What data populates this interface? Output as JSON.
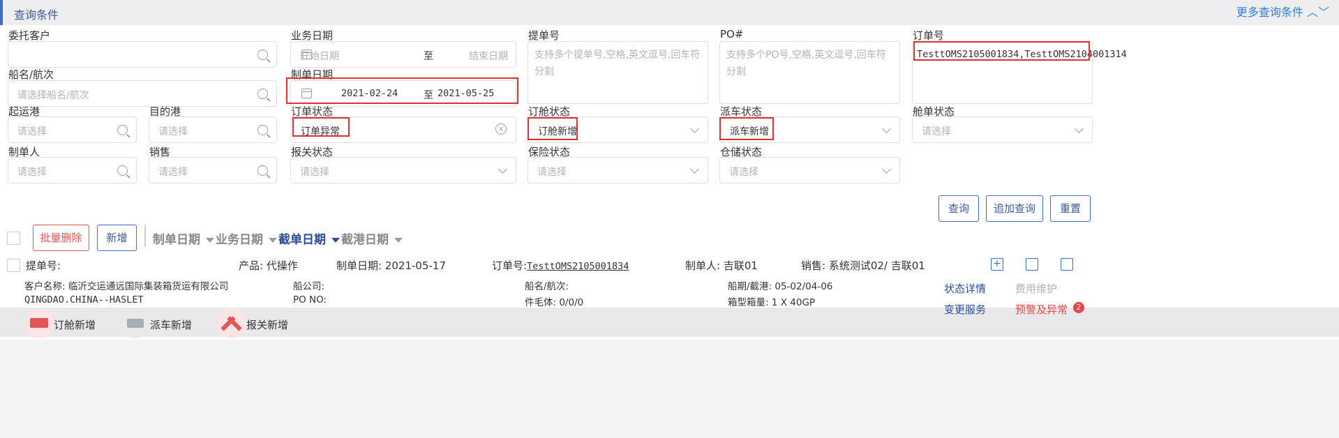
{
  "header": {
    "title": "查询条件",
    "more": "更多查询条件"
  },
  "labels": {
    "client": "委托客户",
    "biz_date": "业务日期",
    "bl_no": "提单号",
    "po": "PO#",
    "order_no": "订单号",
    "vessel": "船名/航次",
    "create_date": "制单日期",
    "pol": "起运港",
    "pod": "目的港",
    "order_status": "订单状态",
    "booking_status": "订舱状态",
    "truck_status": "派车状态",
    "manifest_status": "舱单状态",
    "creator": "制单人",
    "sales": "销售",
    "customs_status": "报关状态",
    "insurance_status": "保险状态",
    "warehouse_status": "仓储状态"
  },
  "inputs": {
    "vessel_ph": "请选择船名/航次",
    "select_ph": "请选择",
    "biz_start_ph": "开始日期",
    "to": "至",
    "biz_end_ph": "结束日期",
    "create_start": "2021-02-24",
    "create_end": "2021-05-25",
    "bl_ph": "支持多个提单号,空格,英文逗号,回车符分割",
    "po_ph": "支持多个PO号,空格,英文逗号,回车符分割",
    "order_no_value": "TesttOMS2105001834,TesttOMS2104001314",
    "order_status_value": "订单异常",
    "booking_status_value": "订舱新增",
    "truck_status_value": "派车新增"
  },
  "buttons": {
    "query": "查询",
    "append_query": "追加查询",
    "reset": "重置",
    "batch_delete": "批量删除",
    "add": "新增"
  },
  "sort": [
    "制单日期",
    "业务日期",
    "截单日期",
    "截港日期"
  ],
  "row": {
    "bl": "提单号:",
    "product": "产品: 代操作",
    "create_date": "制单日期: 2021-05-17",
    "order_label": "订单号:",
    "order_no": "TesttOMS2105001834",
    "creator": "制单人: 吉联01",
    "sales": "销售: 系统测试02/ 吉联01",
    "customer": "客户名称: 临沂交运通远国际集装箱货运有限公司",
    "shipping_co": "船公司:",
    "vessel": "船名/航次:",
    "schedule": "船期/截港: 05-02/04-06",
    "route": "QINGDAO.CHINA--HASLET",
    "po_no": "PO NO:",
    "pieces": "件毛体: 0/0/0",
    "container": "箱型箱量: 1 X 40GP",
    "status_detail": "状态详情",
    "fee": "费用维护",
    "change": "变更服务",
    "alert": "预警及异常",
    "alert_count": "2",
    "badges": [
      "订舱新增",
      "派车新增",
      "报关新增"
    ]
  },
  "colors": {
    "accent": "#3b6fc9",
    "red_box": "#e03030",
    "alert": "#e84545"
  }
}
